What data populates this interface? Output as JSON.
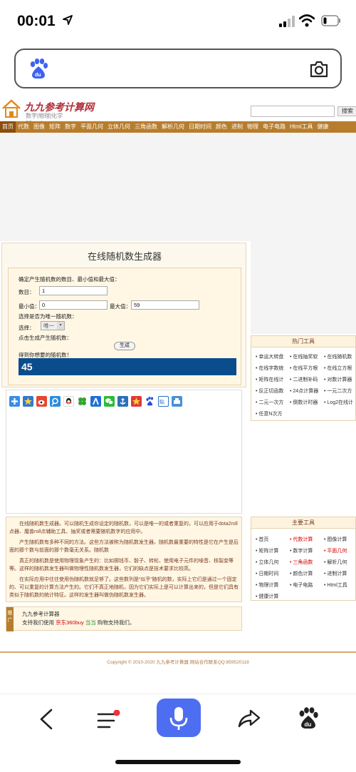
{
  "status": {
    "time": "00:01"
  },
  "site": {
    "logo_title": "九九参考计算网",
    "logo_sub": "数字|物理|化学 99cankao.com",
    "search_button": "搜索"
  },
  "nav": [
    "首页",
    "代数",
    "图像",
    "矩阵",
    "数字",
    "平面几何",
    "立体几何",
    "三角函数",
    "解析几何",
    "日期时间",
    "颜色",
    "进制",
    "物理",
    "电子电路",
    "Html工具",
    "健康"
  ],
  "generator": {
    "title": "在线随机数生成器",
    "instruction": "确定产生随机数的数目、最小值和最大值：",
    "count_label": "数目：",
    "count_value": "1",
    "min_label": "最小值：",
    "min_value": "0",
    "max_label": "最大值：",
    "max_value": "59",
    "unique_question": "选择是否为唯一随机数：",
    "select_label": "选择：",
    "select_value": "唯一",
    "click_label": "点击生成产生随机数：",
    "generate_button": "生成",
    "result_label": "得到你想要的随机数！",
    "result_value": "45"
  },
  "description": {
    "p1": "在线随机数生成器。可以随机生成你设定的随机数，可以是唯一的或者重复的，可以应用于dota2roll点器、魔兽roll点辅助工具、抽奖或者需要随机数字的应用中。",
    "p2": "产生随机数有多种不同的方法。这些方法被称为随机数发生器。随机数最重要的特性是它在产生是后面的那个数与前面的那个数毫无关系。随机数",
    "p3": "真正的随机数是使用物理现象产生的：比如掷钱币、骰子、转轮、使用电子元件的噪音、核裂变等等。这样的随机数发生器叫做物理性随机数发生器，它们的缺点是技术要求比较高。",
    "p4": "在实际应用中往往使用伪随机数就足够了。这些数列是“似乎”随机的数，实际上它们是通过一个固定的、可以重复的计算方法产生的。它们不真正地随机，因为它们实际上是可以计算出来的，但是它们具有类似于随机数的统计特征。这样的发生器叫做伪随机数发生器。"
  },
  "support": {
    "tag": "推广",
    "title": "九九参考计算器",
    "text_prefix": "支持我们使用",
    "link1": "京东",
    "link2": "360buy",
    "link3": "当当",
    "text_suffix": "购物支持我们。"
  },
  "hot_tools": {
    "title": "热门工具",
    "items": [
      "幸运大转盘",
      "在线抽奖软",
      "在线随机数",
      "在线字数统",
      "在线平方根",
      "在线立方根",
      "矩阵在线计",
      "二进制补码",
      "对数计算器",
      "反正切函数",
      "24点计算器",
      "一元二次方",
      "二元一次方",
      "倒数计时器",
      "Log2在线计",
      "任意N次方"
    ]
  },
  "main_tools": {
    "title": "主要工具",
    "items": [
      "首页",
      "代数计算",
      "图像计算",
      "矩阵计算",
      "数字计算",
      "平面几何",
      "立体几何",
      "三角函数",
      "解析几何",
      "日期时间",
      "颜色计算",
      "进制计算",
      "物理计算",
      "电子电路",
      "Html工具",
      "健康计算"
    ]
  },
  "footer": {
    "text": "Copyright © 2010-2020 九九参考计算器 网站合作联系QQ:859520118"
  },
  "colors": {
    "nav_bg": "#b87d2c",
    "result_bg": "#0a4d8c",
    "mic_bg": "#4e6ef2"
  }
}
